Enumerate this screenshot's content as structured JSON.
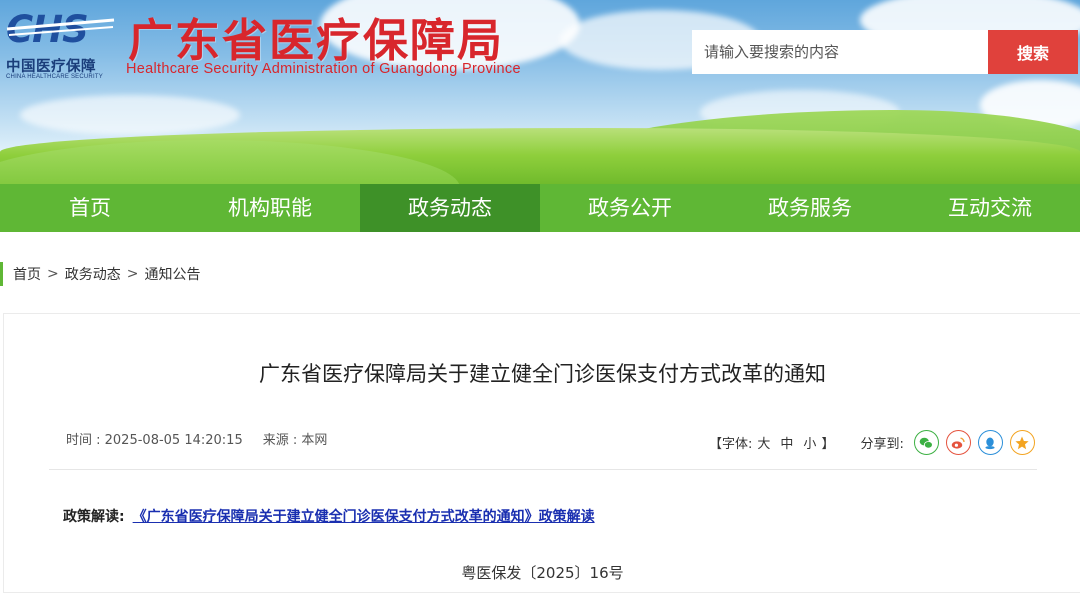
{
  "header": {
    "logo_letters": "CHS",
    "logo_cn": "中国医疗保障",
    "logo_en": "CHINA HEALTHCARE SECURITY",
    "title": "广东省医疗保障局",
    "subtitle": "Healthcare Security Administration of Guangdong Province",
    "search_placeholder": "请输入要搜索的内容",
    "search_button": "搜索"
  },
  "nav": {
    "items": [
      {
        "label": "首页"
      },
      {
        "label": "机构职能"
      },
      {
        "label": "政务动态"
      },
      {
        "label": "政务公开"
      },
      {
        "label": "政务服务"
      },
      {
        "label": "互动交流"
      }
    ],
    "active_index": 2
  },
  "breadcrumb": {
    "items": [
      "首页",
      "政务动态",
      "通知公告"
    ],
    "separator": ">"
  },
  "article": {
    "title": "广东省医疗保障局关于建立健全门诊医保支付方式改革的通知",
    "time": "时间 : 2025-08-05 14:20:15",
    "source": "来源 : 本网",
    "font_label": "【字体:",
    "font_sizes": [
      "大",
      "中",
      "小"
    ],
    "font_close": "】",
    "share_label": "分享到:",
    "share_icons": [
      "wechat-icon",
      "weibo-icon",
      "qq-icon",
      "qzone-icon"
    ],
    "policy_label": "政策解读:",
    "policy_link": "《广东省医疗保障局关于建立健全门诊医保支付方式改革的通知》政策解读",
    "doc_number": "粤医保发〔2025〕16号"
  },
  "colors": {
    "brand_red": "#d8262c",
    "nav_green": "#5fb735",
    "nav_active": "#3e9128",
    "search_button": "#e0413c",
    "link_blue": "#1a2fb0"
  }
}
